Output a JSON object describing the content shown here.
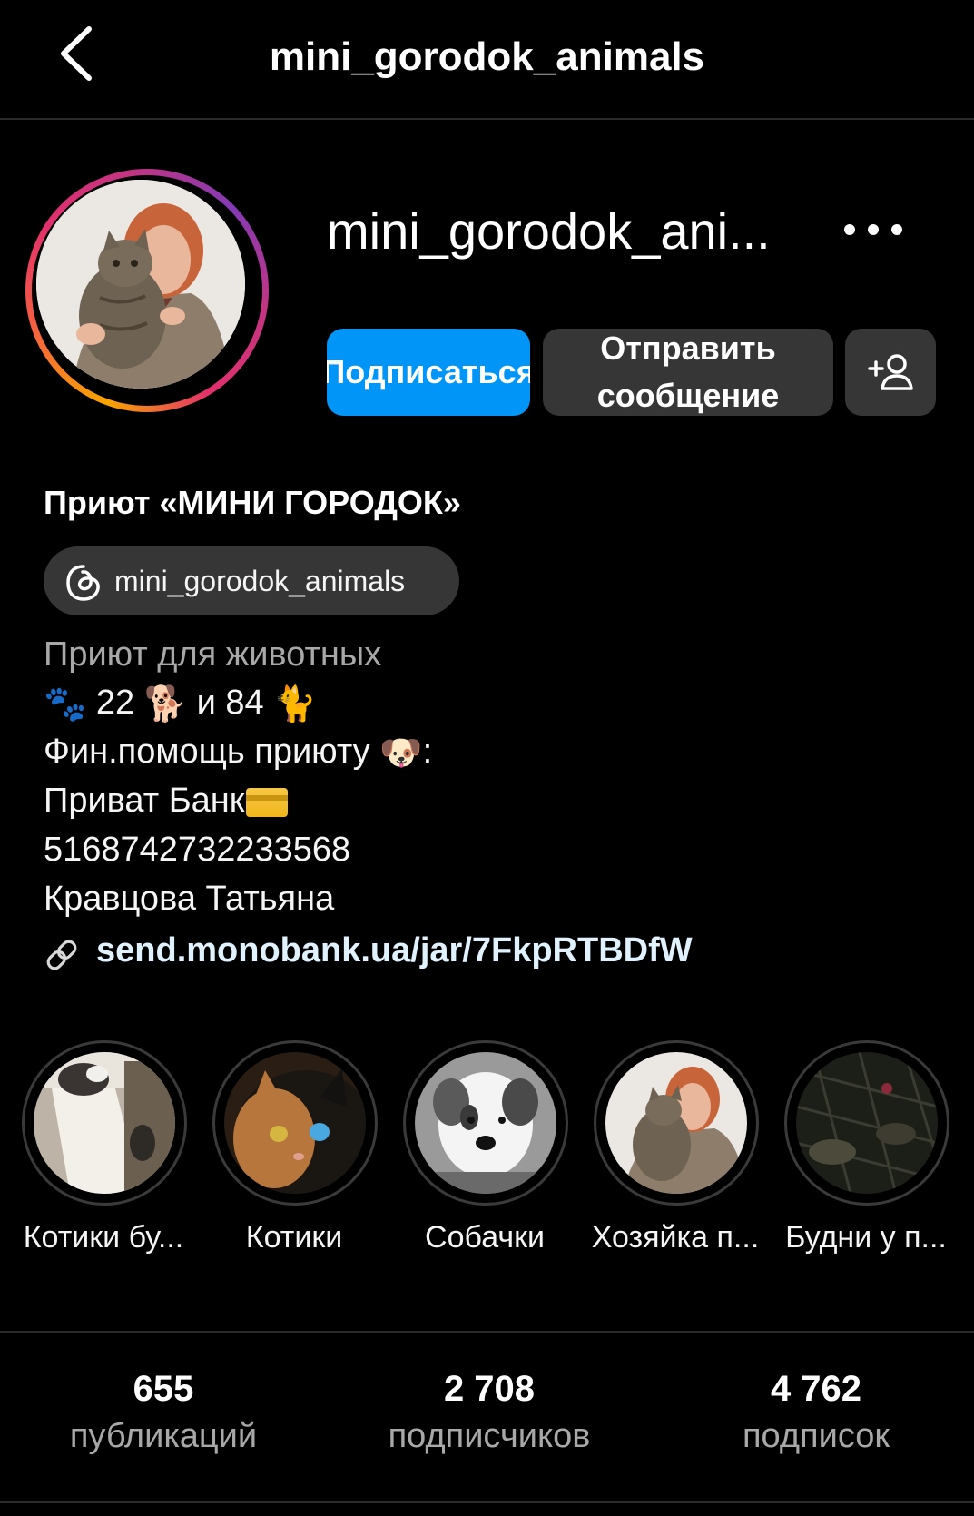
{
  "header": {
    "title": "mini_gorodok_animals",
    "back_icon": "chevron-left-icon"
  },
  "profile": {
    "username_truncated": "mini_gorodok_ani...",
    "more_icon": "more-horizontal-icon",
    "avatar_ring_colors": [
      "#f9a400",
      "#e1306c",
      "#c13584"
    ]
  },
  "actions": {
    "follow_label": "Подписаться",
    "message_label_line1": "Отправить",
    "message_label_line2": "сообщение",
    "suggest_icon": "add-person-icon",
    "follow_color": "#0095f6",
    "secondary_color": "#363636"
  },
  "bio": {
    "name": "Приют «МИНИ ГОРОДОК»",
    "threads_handle": "mini_gorodok_animals",
    "category": "Приют для животных",
    "counts_line": {
      "paws": "🐾",
      "dogs_count": "22",
      "dog_emoji": "🐕",
      "and": "и",
      "cats_count": "84",
      "cat_emoji": "🐈"
    },
    "help_line": "Фин.помощь приюту",
    "help_emoji": "🐶",
    "help_suffix": ":",
    "bank_line": "Приват Банк",
    "card_number": "5168742732233568",
    "owner": "Кравцова Татьяна",
    "link": "send.monobank.ua/jar/7FkpRTBDfW",
    "link_color": "#e0f1ff"
  },
  "highlights": [
    {
      "label": "Котики бу..."
    },
    {
      "label": "Котики"
    },
    {
      "label": "Собачки"
    },
    {
      "label": "Хозяйка п..."
    },
    {
      "label": "Будни у п..."
    }
  ],
  "stats": [
    {
      "value": "655",
      "label": "публикаций"
    },
    {
      "value": "2 708",
      "label": "подписчиков"
    },
    {
      "value": "4 762",
      "label": "подписок"
    }
  ]
}
